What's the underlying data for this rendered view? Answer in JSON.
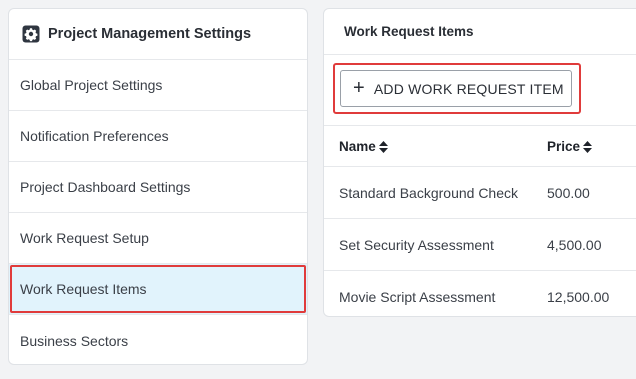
{
  "sidebar": {
    "title": "Project Management Settings",
    "title_icon": "gear-icon",
    "items": [
      {
        "label": "Global Project Settings",
        "active": false
      },
      {
        "label": "Notification Preferences",
        "active": false
      },
      {
        "label": "Project Dashboard Settings",
        "active": false
      },
      {
        "label": "Work Request Setup",
        "active": false
      },
      {
        "label": "Work Request Items",
        "active": true
      },
      {
        "label": "Business Sectors",
        "active": false
      }
    ]
  },
  "panel": {
    "title": "Work Request Items",
    "add_button": {
      "icon": "plus-icon",
      "label": "ADD WORK REQUEST ITEM"
    },
    "columns": [
      {
        "label": "Name",
        "icon": "sort-icon"
      },
      {
        "label": "Price",
        "icon": "sort-icon"
      }
    ],
    "rows": [
      {
        "name": "Standard Background Check",
        "price": "500.00"
      },
      {
        "name": "Set Security Assessment",
        "price": "4,500.00"
      },
      {
        "name": "Movie Script Assessment",
        "price": "12,500.00"
      }
    ]
  },
  "colors": {
    "highlight": "#e03b3b",
    "active_bg": "#e1f3fc"
  }
}
